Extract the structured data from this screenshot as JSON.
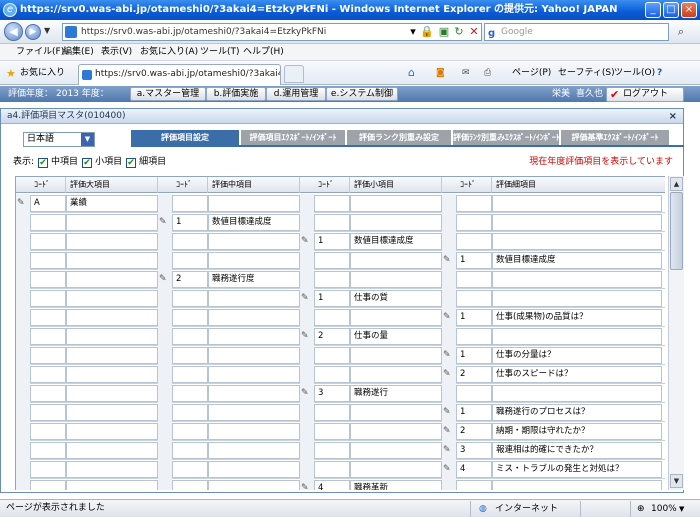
{
  "window": {
    "title": "https://srv0.was-abi.jp/otameshi0/?3akai4=EtzkyPkFNi - Windows Internet Explorer の提供元: Yahoo! JAPAN"
  },
  "browser": {
    "url": "https://srv0.was-abi.jp/otameshi0/?3akai4=EtzkyPkFNi",
    "search_placeholder": "Google",
    "menu": [
      "ファイル(F)",
      "編集(E)",
      "表示(V)",
      "お気に入り(A)",
      "ツール(T)",
      "ヘルプ(H)"
    ],
    "favorites_label": "お気に入り",
    "tab_title": "https://srv0.was-abi.jp/otameshi0/?3akai4=EtzkyP...",
    "commands": [
      "ページ(P)",
      "セーフティ(S)",
      "ツール(O)"
    ]
  },
  "app": {
    "fiscal_year_label": "評価年度：",
    "fiscal_year_value": "2013 年度：",
    "nav": [
      "a.マスター管理",
      "b.評価実施",
      "d.運用管理",
      "e.システム制御"
    ],
    "user_last": "栄美",
    "user_first": "喜久也",
    "logout": "ログアウト",
    "panel_title": "a4.評価項目マスタ(010400)",
    "language": "日本語",
    "tabs": [
      "評価項目設定",
      "評価項目ｴｸｽﾎﾟｰﾄ/ｲﾝﾎﾟｰﾄ",
      "評価ランク別重み設定",
      "評価ﾗﾝｸ別重みｴｸｽﾎﾟｰﾄ/ｲﾝﾎﾟｰﾄ",
      "評価基準ｴｸｽﾎﾟｰﾄ/ｲﾝﾎﾟｰﾄ"
    ],
    "show_label": "表示:",
    "show_options": [
      "中項目",
      "小項目",
      "細項目"
    ],
    "notice": "現在年度評価項目を表示しています",
    "columns": [
      "ｺｰﾄﾞ",
      "評価大項目",
      "ｺｰﾄﾞ",
      "評価中項目",
      "ｺｰﾄﾞ",
      "評価小項目",
      "ｺｰﾄﾞ",
      "評価細項目"
    ],
    "rows": [
      {
        "level": 0,
        "code": "A",
        "name": "業績"
      },
      {
        "level": 1,
        "code": "1",
        "name": "数値目標達成度"
      },
      {
        "level": 2,
        "code": "1",
        "name": "数値目標達成度"
      },
      {
        "level": 3,
        "code": "1",
        "name": "数値目標達成度"
      },
      {
        "level": 1,
        "code": "2",
        "name": "職務遂行度"
      },
      {
        "level": 2,
        "code": "1",
        "name": "仕事の質"
      },
      {
        "level": 3,
        "code": "1",
        "name": "仕事(成果物)の品質は？"
      },
      {
        "level": 2,
        "code": "2",
        "name": "仕事の量"
      },
      {
        "level": 3,
        "code": "1",
        "name": "仕事の分量は？"
      },
      {
        "level": 3,
        "code": "2",
        "name": "仕事のスピードは？"
      },
      {
        "level": 2,
        "code": "3",
        "name": "職務遂行"
      },
      {
        "level": 3,
        "code": "1",
        "name": "職務遂行のプロセスは？"
      },
      {
        "level": 3,
        "code": "2",
        "name": "納期・期限は守れたか？"
      },
      {
        "level": 3,
        "code": "3",
        "name": "報連相は的確にできたか？"
      },
      {
        "level": 3,
        "code": "4",
        "name": "ミス・トラブルの発生と対処は？"
      },
      {
        "level": 2,
        "code": "4",
        "name": "職務革新"
      }
    ]
  },
  "status": {
    "left": "ページが表示されました",
    "zone": "インターネット",
    "zoom": "100%"
  }
}
